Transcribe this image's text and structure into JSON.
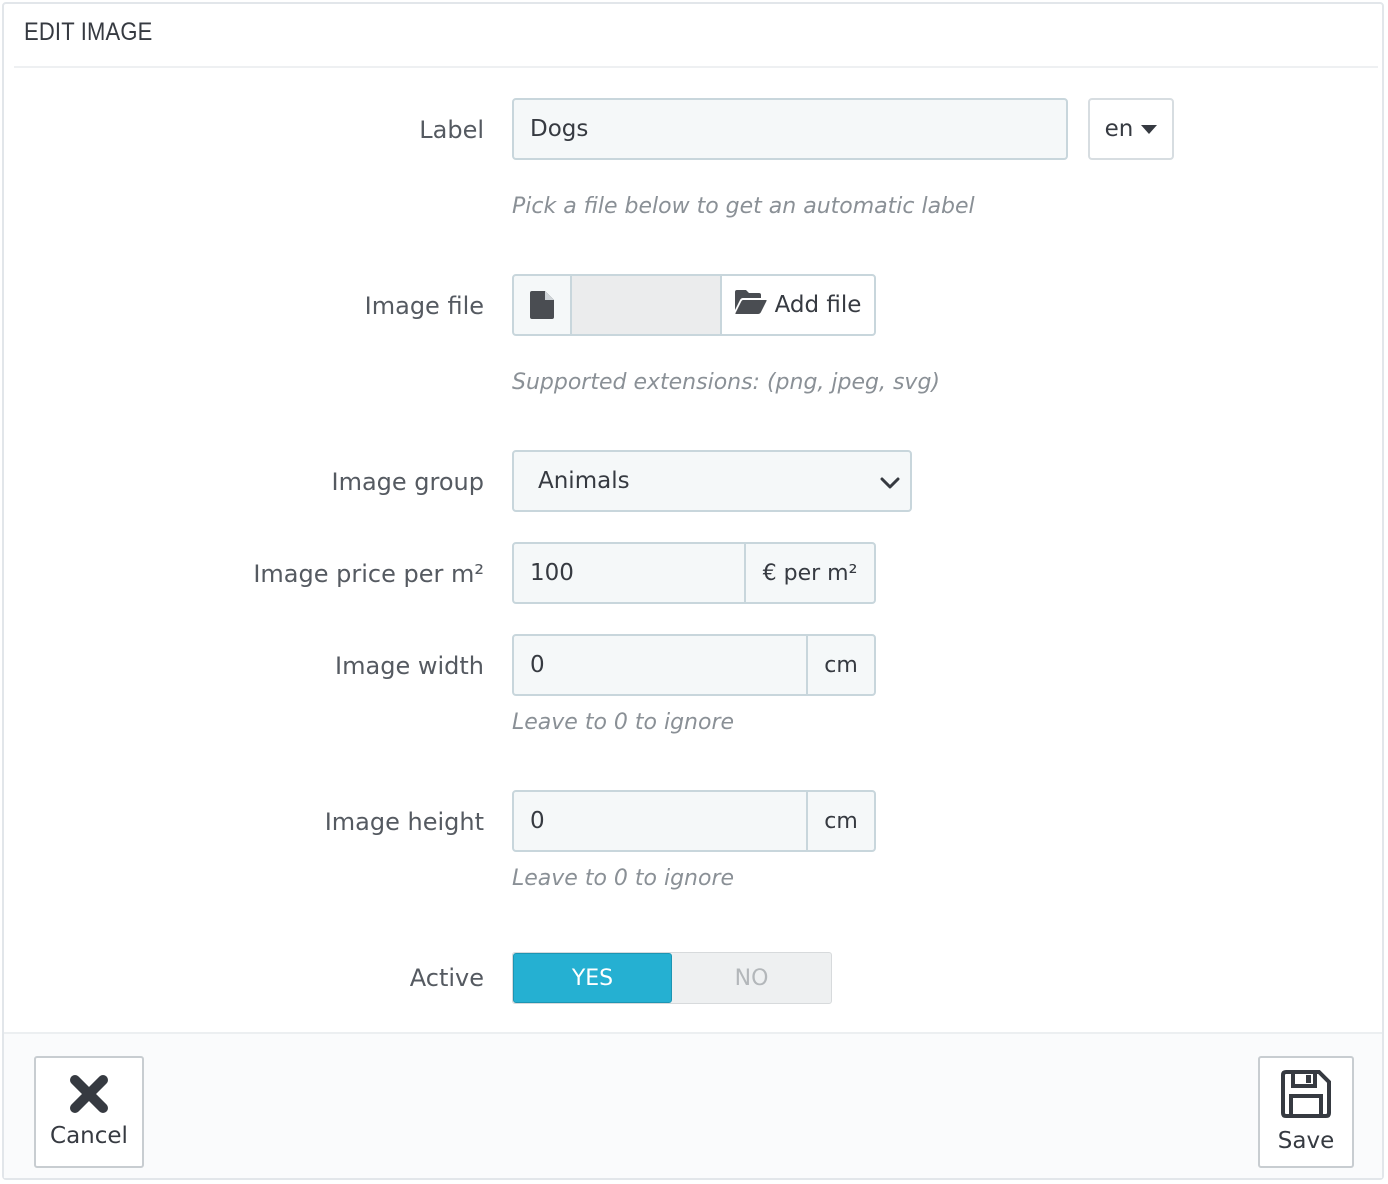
{
  "panel": {
    "title": "EDIT IMAGE"
  },
  "label_field": {
    "label": "Label",
    "value": "Dogs",
    "language": "en",
    "help": "Pick a file below to get an automatic label"
  },
  "image_file": {
    "label": "Image file",
    "file_icon": "file-icon",
    "button_icon": "folder-open-icon",
    "button_label": "Add file",
    "help": "Supported extensions: (png, jpeg, svg)"
  },
  "image_group": {
    "label": "Image group",
    "selected": "Animals"
  },
  "price": {
    "label": "Image price per m²",
    "value": "100",
    "addon": "€ per m²"
  },
  "width": {
    "label": "Image width",
    "value": "0",
    "addon": "cm",
    "help": "Leave to 0 to ignore"
  },
  "height": {
    "label": "Image height",
    "value": "0",
    "addon": "cm",
    "help": "Leave to 0 to ignore"
  },
  "active": {
    "label": "Active",
    "yes": "YES",
    "no": "NO",
    "selected": "YES"
  },
  "footer": {
    "cancel_label": "Cancel",
    "cancel_icon": "close-icon",
    "save_label": "Save",
    "save_icon": "save-icon"
  },
  "colors": {
    "accent": "#25b0d2",
    "border": "#c8d6dc",
    "input_bg": "#f5f8f9"
  }
}
